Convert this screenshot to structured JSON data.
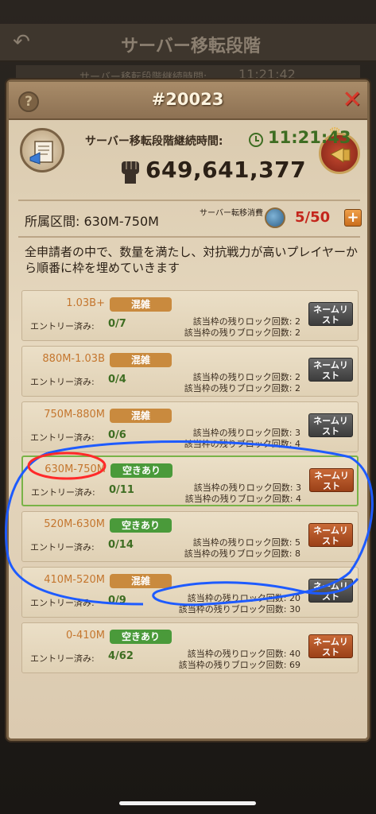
{
  "background": {
    "title": "サーバー移転段階",
    "row_text": "サーバー移転段階継続時間:",
    "row_time": "11:21:42"
  },
  "modal": {
    "title": "#20023",
    "duration_label": "サーバー移転段階継続時間:",
    "duration_time": "11:21:43",
    "power_value": "649,641,377",
    "range_label": "所属区間: 630M-750M",
    "cost_label": "サーバー転移消費",
    "cost_value": "5/50",
    "description": "全申請者の中で、数量を満たし、対抗戦力が高いプレイヤーから順番に枠を埋めていきます"
  },
  "labels": {
    "entry": "エントリー済み:",
    "lock": "該当枠の残りロック回数: ",
    "block": "該当枠の残りブロック回数: ",
    "name_button": "ネームリスト"
  },
  "tiers": [
    {
      "range": "1.03B+",
      "status": "混雑",
      "status_type": "busy",
      "entries": "0/7",
      "lock": "2",
      "block": "2",
      "button": "gray"
    },
    {
      "range": "880M-1.03B",
      "status": "混雑",
      "status_type": "busy",
      "entries": "0/4",
      "lock": "2",
      "block": "2",
      "button": "gray"
    },
    {
      "range": "750M-880M",
      "status": "混雑",
      "status_type": "busy",
      "entries": "0/6",
      "lock": "3",
      "block": "4",
      "button": "gray"
    },
    {
      "range": "630M-750M",
      "status": "空きあり",
      "status_type": "open",
      "entries": "0/11",
      "lock": "3",
      "block": "4",
      "button": "orange"
    },
    {
      "range": "520M-630M",
      "status": "空きあり",
      "status_type": "open",
      "entries": "0/14",
      "lock": "5",
      "block": "8",
      "button": "orange"
    },
    {
      "range": "410M-520M",
      "status": "混雑",
      "status_type": "busy",
      "entries": "0/9",
      "lock": "20",
      "block": "30",
      "button": "gray"
    },
    {
      "range": "0-410M",
      "status": "空きあり",
      "status_type": "open",
      "entries": "4/62",
      "lock": "40",
      "block": "69",
      "button": "orange"
    }
  ],
  "colors": {
    "accent_green": "#3e6d22",
    "range_orange": "#c4762e",
    "close_red": "#d63b2c",
    "annotation_blue": "#1e5bff",
    "annotation_red": "#ff2a2a"
  }
}
